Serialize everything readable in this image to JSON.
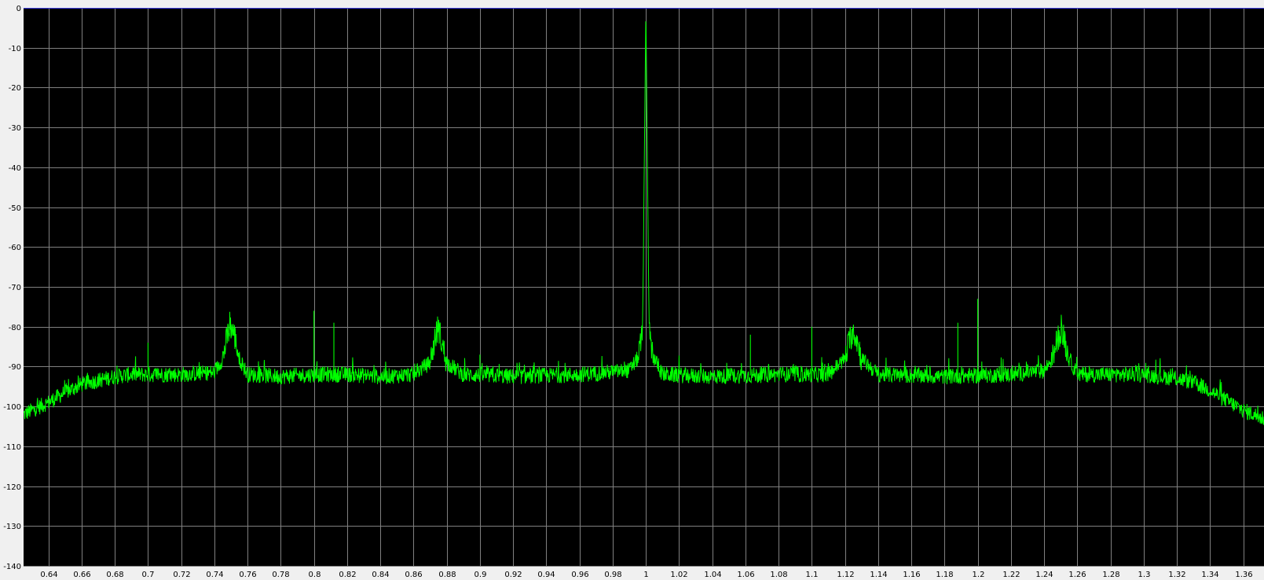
{
  "chart_data": {
    "type": "line",
    "title": "",
    "xlabel": "",
    "ylabel": "",
    "xlim": [
      0.625,
      1.3725
    ],
    "ylim": [
      -140,
      0
    ],
    "x_ticks": [
      0.64,
      0.66,
      0.68,
      0.7,
      0.72,
      0.74,
      0.76,
      0.78,
      0.8,
      0.82,
      0.84,
      0.86,
      0.88,
      0.9,
      0.92,
      0.94,
      0.96,
      0.98,
      1,
      1.02,
      1.04,
      1.06,
      1.08,
      1.1,
      1.12,
      1.14,
      1.16,
      1.18,
      1.2,
      1.22,
      1.24,
      1.26,
      1.28,
      1.3,
      1.32,
      1.34,
      1.36
    ],
    "x_tick_labels": [
      "0.64",
      "0.66",
      "0.68",
      "0.7",
      "0.72",
      "0.74",
      "0.76",
      "0.78",
      "0.8",
      "0.82",
      "0.84",
      "0.86",
      "0.88",
      "0.9",
      "0.92",
      "0.94",
      "0.96",
      "0.98",
      "1",
      "1.02",
      "1.04",
      "1.06",
      "1.08",
      "1.1",
      "1.12",
      "1.14",
      "1.16",
      "1.18",
      "1.2",
      "1.22",
      "1.24",
      "1.26",
      "1.28",
      "1.3",
      "1.32",
      "1.34",
      "1.36"
    ],
    "y_ticks": [
      0,
      -10,
      -20,
      -30,
      -40,
      -50,
      -60,
      -70,
      -80,
      -90,
      -100,
      -110,
      -120,
      -130,
      -140
    ],
    "y_tick_labels": [
      "0",
      "-10",
      "-20",
      "-30",
      "-40",
      "-50",
      "-60",
      "-70",
      "-80",
      "-90",
      "-100",
      "-110",
      "-120",
      "-130",
      "-140"
    ],
    "grid": true,
    "reference_line": 0,
    "colors": {
      "plot_background": "#000000",
      "trace": "#00ff00",
      "grid": "#808080",
      "reference": "#3a3adf",
      "frame": "#f0f0f0"
    },
    "series": [
      {
        "x": [
          0.625,
          0.63,
          0.64,
          0.65,
          0.66,
          0.67,
          0.68,
          0.69,
          0.7,
          0.72,
          0.74,
          0.745,
          0.748,
          0.75,
          0.752,
          0.755,
          0.76,
          0.78,
          0.8,
          0.82,
          0.84,
          0.86,
          0.87,
          0.873,
          0.875,
          0.877,
          0.88,
          0.89,
          0.92,
          0.96,
          0.99,
          0.995,
          0.998,
          1.0,
          1.002,
          1.005,
          1.01,
          1.04,
          1.08,
          1.11,
          1.12,
          1.123,
          1.125,
          1.127,
          1.13,
          1.14,
          1.18,
          1.22,
          1.24,
          1.245,
          1.248,
          1.25,
          1.252,
          1.255,
          1.26,
          1.28,
          1.3,
          1.32,
          1.33,
          1.34,
          1.35,
          1.36,
          1.3725
        ],
        "y": [
          -102,
          -101,
          -99,
          -96.5,
          -94.5,
          -93.5,
          -92.5,
          -92,
          -92,
          -92,
          -91.5,
          -88,
          -82,
          -80,
          -82,
          -88,
          -92,
          -92.5,
          -92,
          -92,
          -92.5,
          -92,
          -89,
          -83,
          -80,
          -84,
          -89,
          -92,
          -92.5,
          -92,
          -91,
          -88,
          -82,
          0,
          -82,
          -88,
          -92,
          -92.5,
          -92,
          -92,
          -88,
          -83,
          -81,
          -83,
          -88,
          -92,
          -92.5,
          -92,
          -91,
          -88,
          -83,
          -81,
          -83,
          -88,
          -92,
          -92,
          -92,
          -93,
          -94,
          -96,
          -98.5,
          -101,
          -103
        ]
      }
    ],
    "spurs": [
      {
        "x": 0.7,
        "y": -84
      },
      {
        "x": 0.8,
        "y": -76
      },
      {
        "x": 0.812,
        "y": -79
      },
      {
        "x": 0.9,
        "y": -87
      },
      {
        "x": 1.063,
        "y": -82
      },
      {
        "x": 1.1,
        "y": -80
      },
      {
        "x": 1.188,
        "y": -79
      },
      {
        "x": 1.2,
        "y": -73
      }
    ]
  }
}
